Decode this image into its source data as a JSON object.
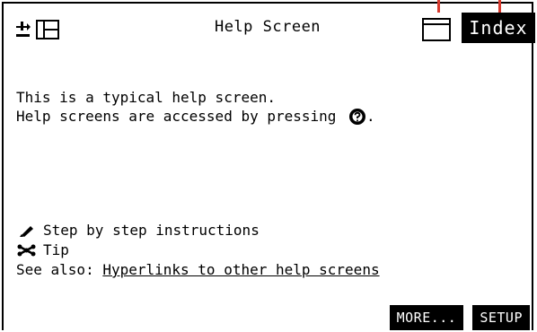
{
  "window": {
    "title": "Help Screen",
    "index_tab": "Index"
  },
  "body": {
    "line1": "This is a typical help screen.",
    "line2": "Help screens are accessed by pressing ",
    "line2_end": "."
  },
  "list": {
    "steps": "Step by step instructions",
    "tip": "Tip",
    "see_also_label": "See also: ",
    "see_also_link": "Hyperlinks to other help screens"
  },
  "buttons": {
    "more": "MORE...",
    "setup": "SETUP"
  },
  "colors": {
    "marker": "#d83a2e"
  },
  "icons": {
    "top_left": [
      "fit-screen-icon",
      "split-view-icon"
    ],
    "window": "window-icon",
    "help": "help-key-icon",
    "steps": "pencil-icon",
    "tip": "tip-icon"
  }
}
